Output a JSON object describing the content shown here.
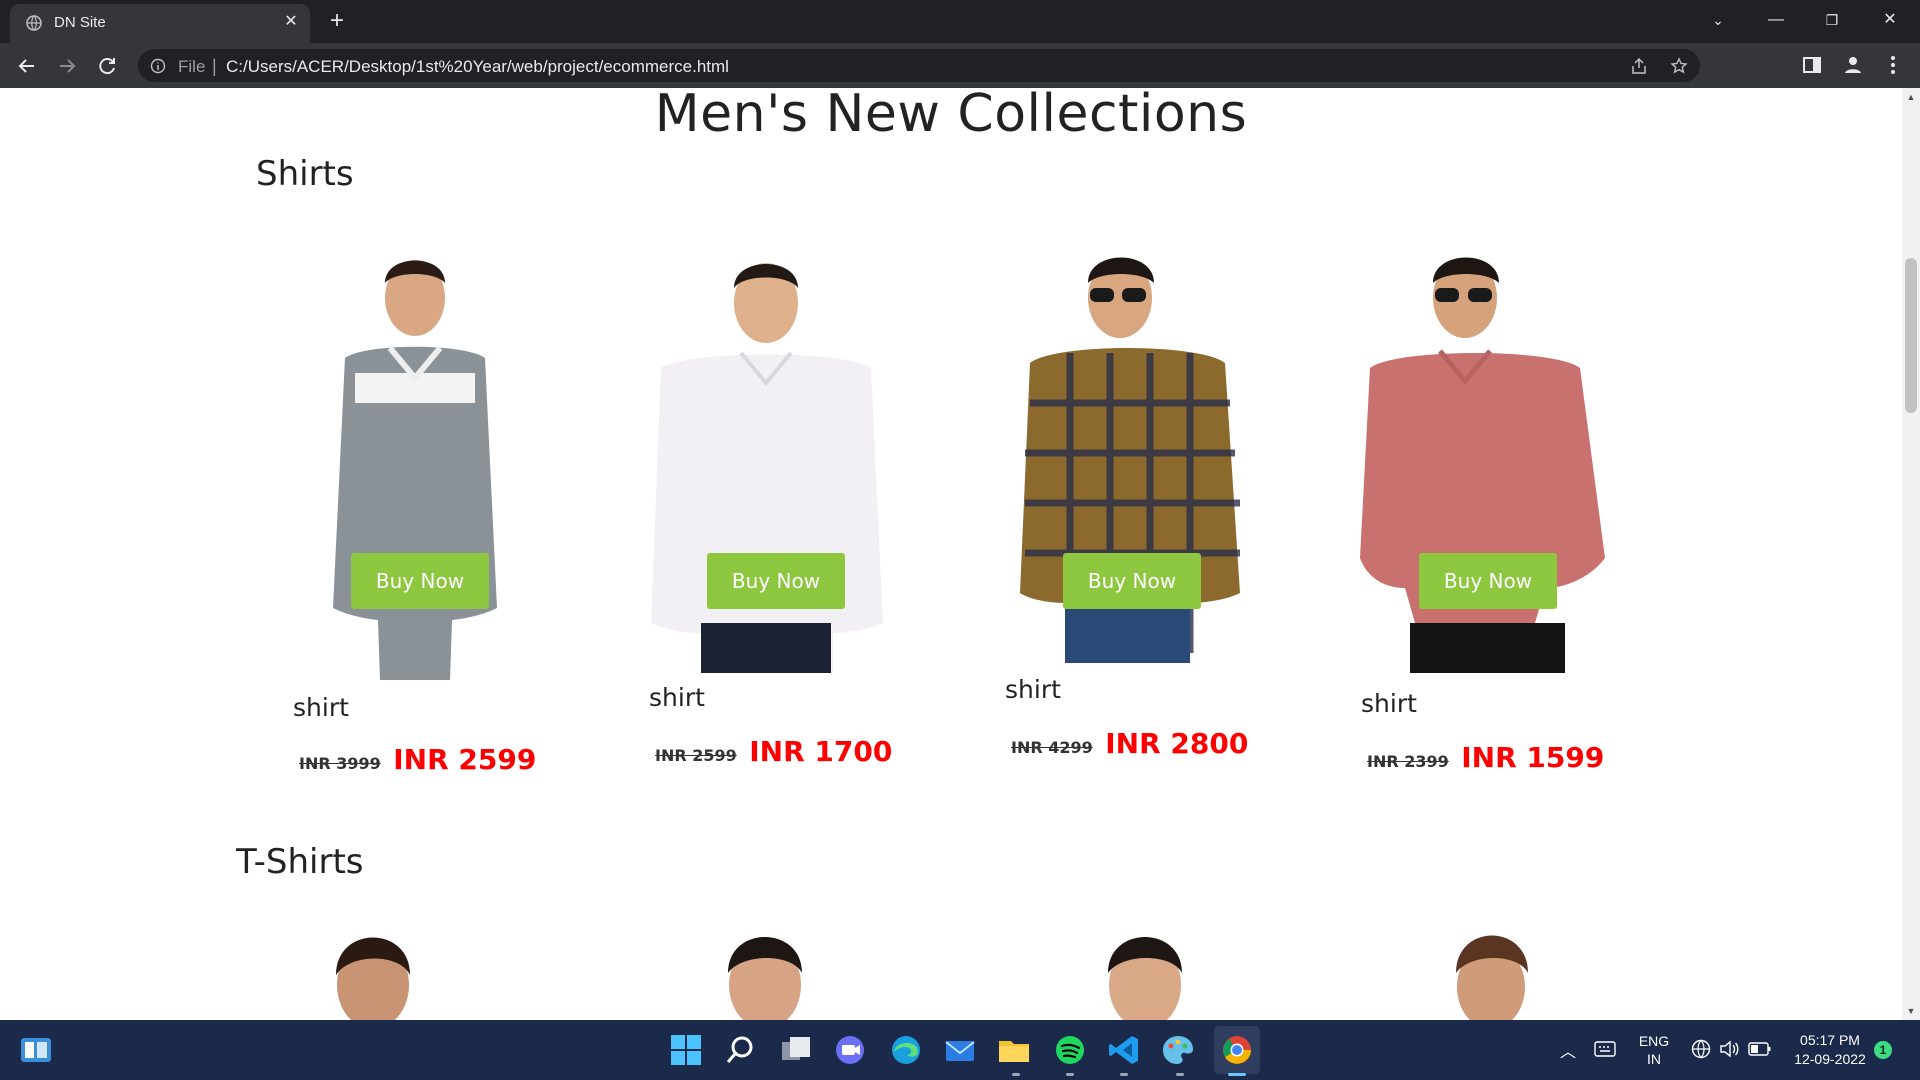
{
  "browser": {
    "tab_title": "DN Site",
    "url_scheme": "File",
    "url": "C:/Users/ACER/Desktop/1st%20Year/web/project/ecommerce.html"
  },
  "page": {
    "title": "Men's New Collections",
    "sections": [
      {
        "title": "Shirts",
        "products": [
          {
            "name": "shirt",
            "old_price": "INR 3999",
            "price": "INR 2599",
            "button": "Buy Now",
            "color": "#8a9298"
          },
          {
            "name": "shirt",
            "old_price": "INR 2599",
            "price": "INR 1700",
            "button": "Buy Now",
            "color": "#f2f0f4"
          },
          {
            "name": "shirt",
            "old_price": "INR 4299",
            "price": "INR 2800",
            "button": "Buy Now",
            "color": "#8c6a2e"
          },
          {
            "name": "shirt",
            "old_price": "INR 2399",
            "price": "INR 1599",
            "button": "Buy Now",
            "color": "#c9716f"
          }
        ]
      },
      {
        "title": "T-Shirts"
      }
    ]
  },
  "taskbar": {
    "lang_top": "ENG",
    "lang_bottom": "IN",
    "time": "05:17 PM",
    "date": "12-09-2022",
    "notification_count": "1"
  }
}
